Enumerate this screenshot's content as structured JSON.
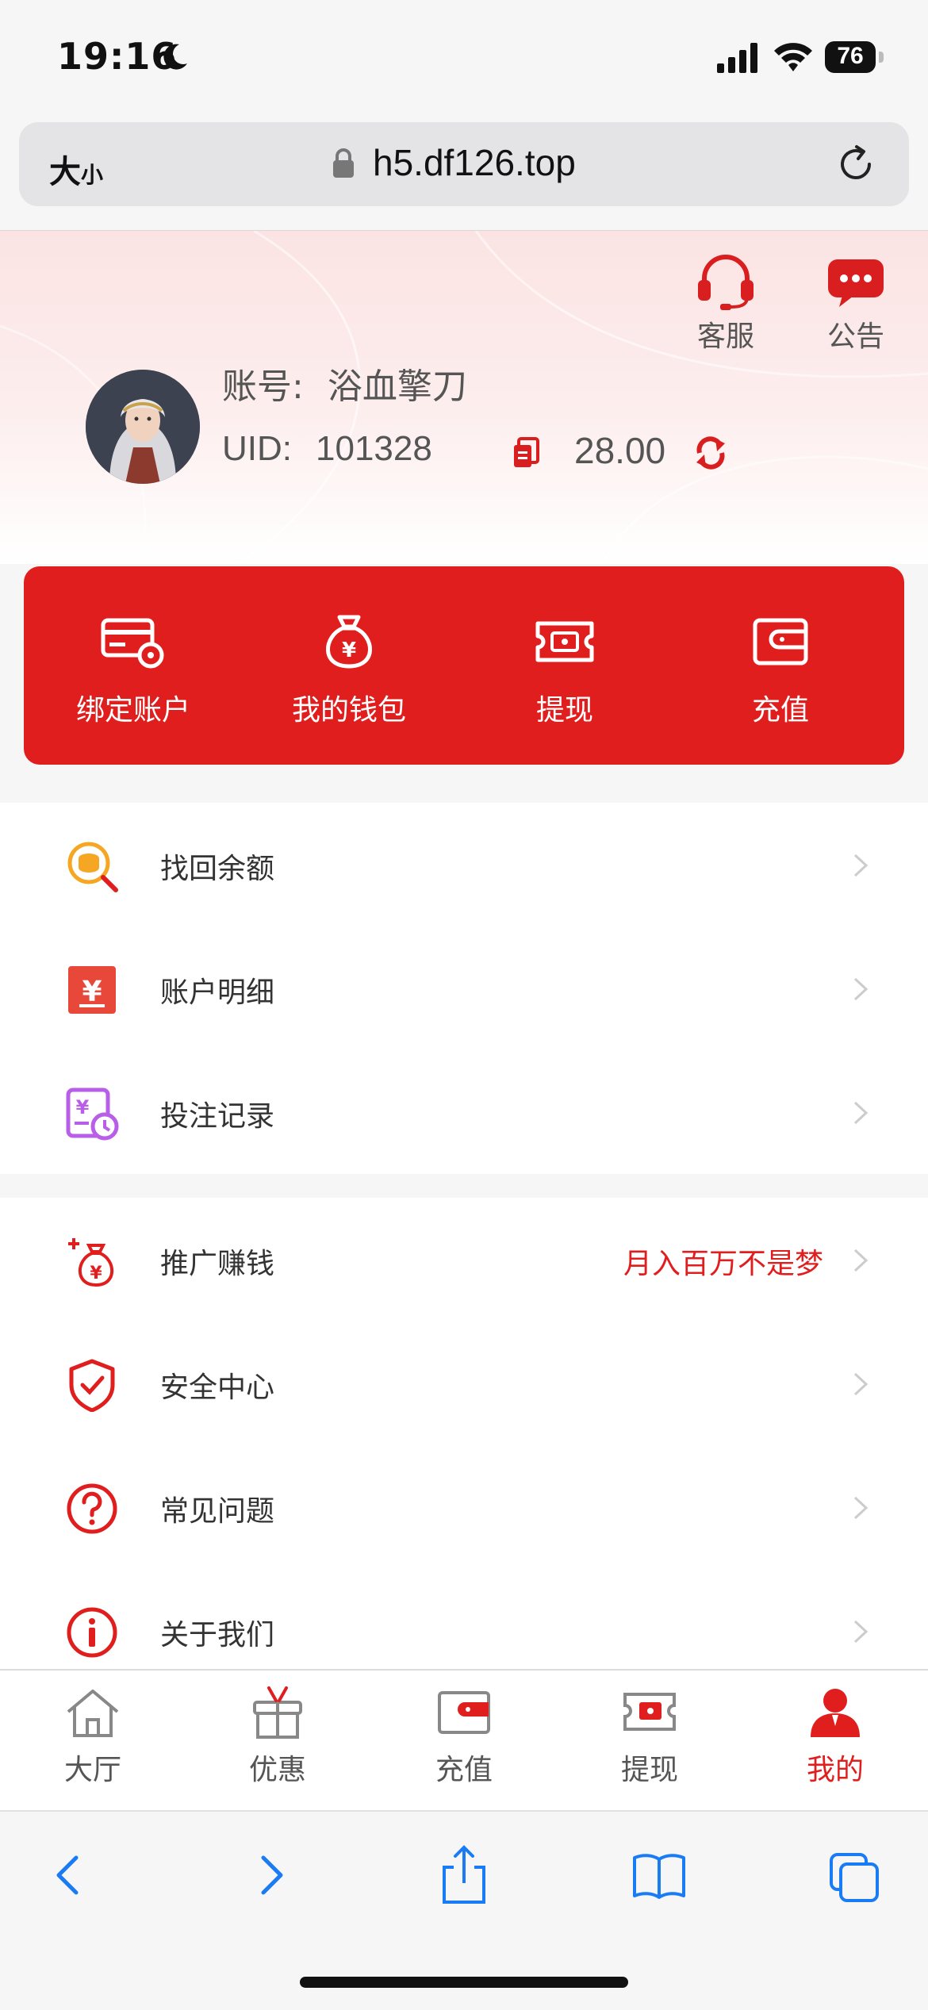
{
  "status_bar": {
    "time": "19:16",
    "battery": "76"
  },
  "browser": {
    "text_size_label": "大",
    "text_size_small": "小",
    "url": "h5.df126.top"
  },
  "header": {
    "service_label": "客服",
    "notice_label": "公告",
    "account_label": "账号:",
    "account_value": "浴血擎刀",
    "uid_label": "UID:",
    "uid_value": "101328",
    "balance": "28.00"
  },
  "actions": [
    {
      "label": "绑定账户",
      "icon": "card-settings-icon"
    },
    {
      "label": "我的钱包",
      "icon": "money-bag-icon"
    },
    {
      "label": "提现",
      "icon": "withdraw-ticket-icon"
    },
    {
      "label": "充值",
      "icon": "wallet-icon"
    }
  ],
  "menu_group_1": [
    {
      "label": "找回余额",
      "icon": "coin-search-icon"
    },
    {
      "label": "账户明细",
      "icon": "ledger-icon"
    },
    {
      "label": "投注记录",
      "icon": "bet-record-icon"
    }
  ],
  "menu_group_2": [
    {
      "label": "推广赚钱",
      "extra": "月入百万不是梦",
      "icon": "promo-bag-icon"
    },
    {
      "label": "安全中心",
      "icon": "shield-icon"
    },
    {
      "label": "常见问题",
      "icon": "question-icon"
    },
    {
      "label": "关于我们",
      "icon": "info-icon"
    }
  ],
  "tabs": [
    {
      "label": "大厅",
      "icon": "home-icon"
    },
    {
      "label": "优惠",
      "icon": "gift-icon"
    },
    {
      "label": "充值",
      "icon": "wallet-icon"
    },
    {
      "label": "提现",
      "icon": "withdraw-icon"
    },
    {
      "label": "我的",
      "icon": "user-icon",
      "active": true
    }
  ],
  "colors": {
    "accent": "#e01e1e",
    "blue": "#1a7cf5"
  }
}
